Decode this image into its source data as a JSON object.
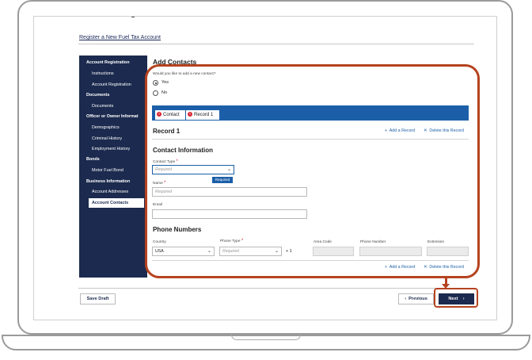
{
  "page": {
    "title": "Register a New Fuel Tax Account"
  },
  "sidebar": {
    "items": [
      {
        "label": "Account Registration",
        "kind": "head"
      },
      {
        "label": "Instructions",
        "kind": "sub"
      },
      {
        "label": "Account Registration",
        "kind": "sub"
      },
      {
        "label": "Documents",
        "kind": "head"
      },
      {
        "label": "Documents",
        "kind": "sub"
      },
      {
        "label": "Officer or Owner Informat",
        "kind": "head"
      },
      {
        "label": "Demographics",
        "kind": "sub"
      },
      {
        "label": "Criminal History",
        "kind": "sub"
      },
      {
        "label": "Employment History",
        "kind": "sub"
      },
      {
        "label": "Bonds",
        "kind": "head"
      },
      {
        "label": "Motor Fuel Bond",
        "kind": "sub"
      },
      {
        "label": "Business Information",
        "kind": "head"
      },
      {
        "label": "Account Addresses",
        "kind": "sub"
      },
      {
        "label": "Account Contacts",
        "kind": "active"
      }
    ]
  },
  "main": {
    "title": "Add Contacts",
    "question": "Would you like to add a new contact?",
    "options": [
      "Yes",
      "No"
    ],
    "selected_option": "Yes"
  },
  "tabs": [
    {
      "label": "Contact",
      "error": "!"
    },
    {
      "label": "Record 1",
      "error": "!"
    }
  ],
  "record": {
    "title": "Record 1",
    "add_label": "Add a Record",
    "delete_label": "Delete this Record"
  },
  "contact_info": {
    "title": "Contact Information",
    "contact_type_label": "Contact Type",
    "contact_type_placeholder": "Required",
    "tooltip": "Required",
    "name_label": "Name",
    "name_placeholder": "Required",
    "email_label": "Email",
    "required_mark": "*"
  },
  "phone": {
    "title": "Phone Numbers",
    "country_label": "Country",
    "country_value": "USA",
    "phone_type_label": "Phone Type",
    "phone_type_placeholder": "Required",
    "country_code": "+ 1",
    "area_code_label": "Area Code",
    "phone_number_label": "Phone Number",
    "extension_label": "Extension"
  },
  "footer": {
    "save_draft": "Save Draft",
    "previous": "Previous",
    "next": "Next"
  },
  "colors": {
    "navy": "#1b2a4e",
    "blue": "#1c5fa8",
    "highlight": "#b5431f",
    "error": "#d9232e"
  },
  "icons": {
    "prev": "chevron-left-icon",
    "next": "chevron-right-icon",
    "add": "plus-icon",
    "delete": "close-icon",
    "error": "error-icon"
  }
}
